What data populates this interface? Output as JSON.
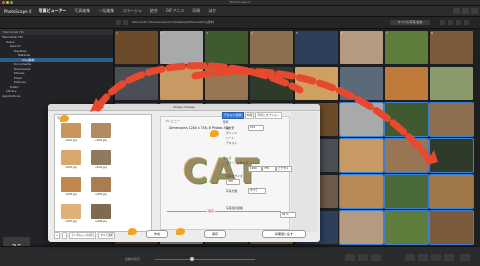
{
  "window": {
    "title": "PhotoScape X"
  },
  "menubar": {
    "app_name": "PhotoScape X",
    "tabs": [
      "写真ビューアー",
      "写真編集",
      "一括編集",
      "コラージュ",
      "結合",
      "GIFアニメ",
      "印刷",
      "ほか"
    ]
  },
  "toolbar": {
    "path": "Macintosh HD/Users/kenichi/Desktop/Material/blog素材",
    "sort_label": "すべての写真/名前"
  },
  "sidebar": {
    "header": "Macintosh HD",
    "items": [
      {
        "label": "Macintosh HD",
        "selected": false
      },
      {
        "label": "Users",
        "selected": false
      },
      {
        "label": "kenichi",
        "selected": false
      },
      {
        "label": "Desktop",
        "selected": false
      },
      {
        "label": "Material",
        "selected": false
      },
      {
        "label": "blog素材",
        "selected": true
      },
      {
        "label": "Documents",
        "selected": false
      },
      {
        "label": "Downloads",
        "selected": false
      },
      {
        "label": "Movies",
        "selected": false
      },
      {
        "label": "Music",
        "selected": false
      },
      {
        "label": "Pictures",
        "selected": false
      },
      {
        "label": "Public",
        "selected": false
      },
      {
        "label": "Library",
        "selected": false
      },
      {
        "label": "Applications",
        "selected": false
      }
    ]
  },
  "grid": {
    "numbers": [
      "1",
      "2",
      "3",
      "4",
      "5",
      "6",
      "7",
      "8",
      "9",
      "10",
      "11",
      "12",
      "13",
      "14",
      "15",
      "16",
      "17",
      "18",
      "19",
      "20"
    ]
  },
  "statusbar": {
    "zoom_label": "全体の表示"
  },
  "dialog": {
    "title": "Shape Collage",
    "list_header": "写真",
    "captions": [
      "cat01.jpg",
      "cat02.jpg",
      "cat03.jpg",
      "cat04.jpg",
      "cat05.jpg",
      "cat06.jpg",
      "cat07.jpg",
      "cat08.jpg"
    ],
    "bottom_buttons": [
      "+",
      "-",
      "ランダムに入れ替え",
      "すべて選択"
    ],
    "preview_header": "プレビュー",
    "dimensions": "Dimensions 1280 x 758, 8 Photos 300",
    "preview_text": "CAT",
    "save_label": "保存",
    "tabs": [
      "テキスト/形状",
      "外観",
      "背景とオプション"
    ],
    "settings": {
      "shape_label": "形状",
      "shape_options": [
        "長方形",
        "グリッド",
        "ハート",
        "テキスト"
      ],
      "text_value": "CAT",
      "size_label": "サイズ",
      "collage_size_label": "コラージュサイズ",
      "width_value": "1280",
      "height_value": "758",
      "unit": "ピクセル",
      "photo_size_label": "写真のサイズ",
      "photo_size_value": "300",
      "photo_count_label": "写真の数",
      "photo_count_value": "すべて",
      "spacing_label": "写真間の距離",
      "spacing_value": "40 %"
    },
    "ok_label": "作成",
    "reset_label": "保存",
    "default_label": "初期値に戻す"
  },
  "colors": {
    "accent": "#3b7ddd",
    "annotation": "#e8492e",
    "marker": "#f0a427"
  }
}
